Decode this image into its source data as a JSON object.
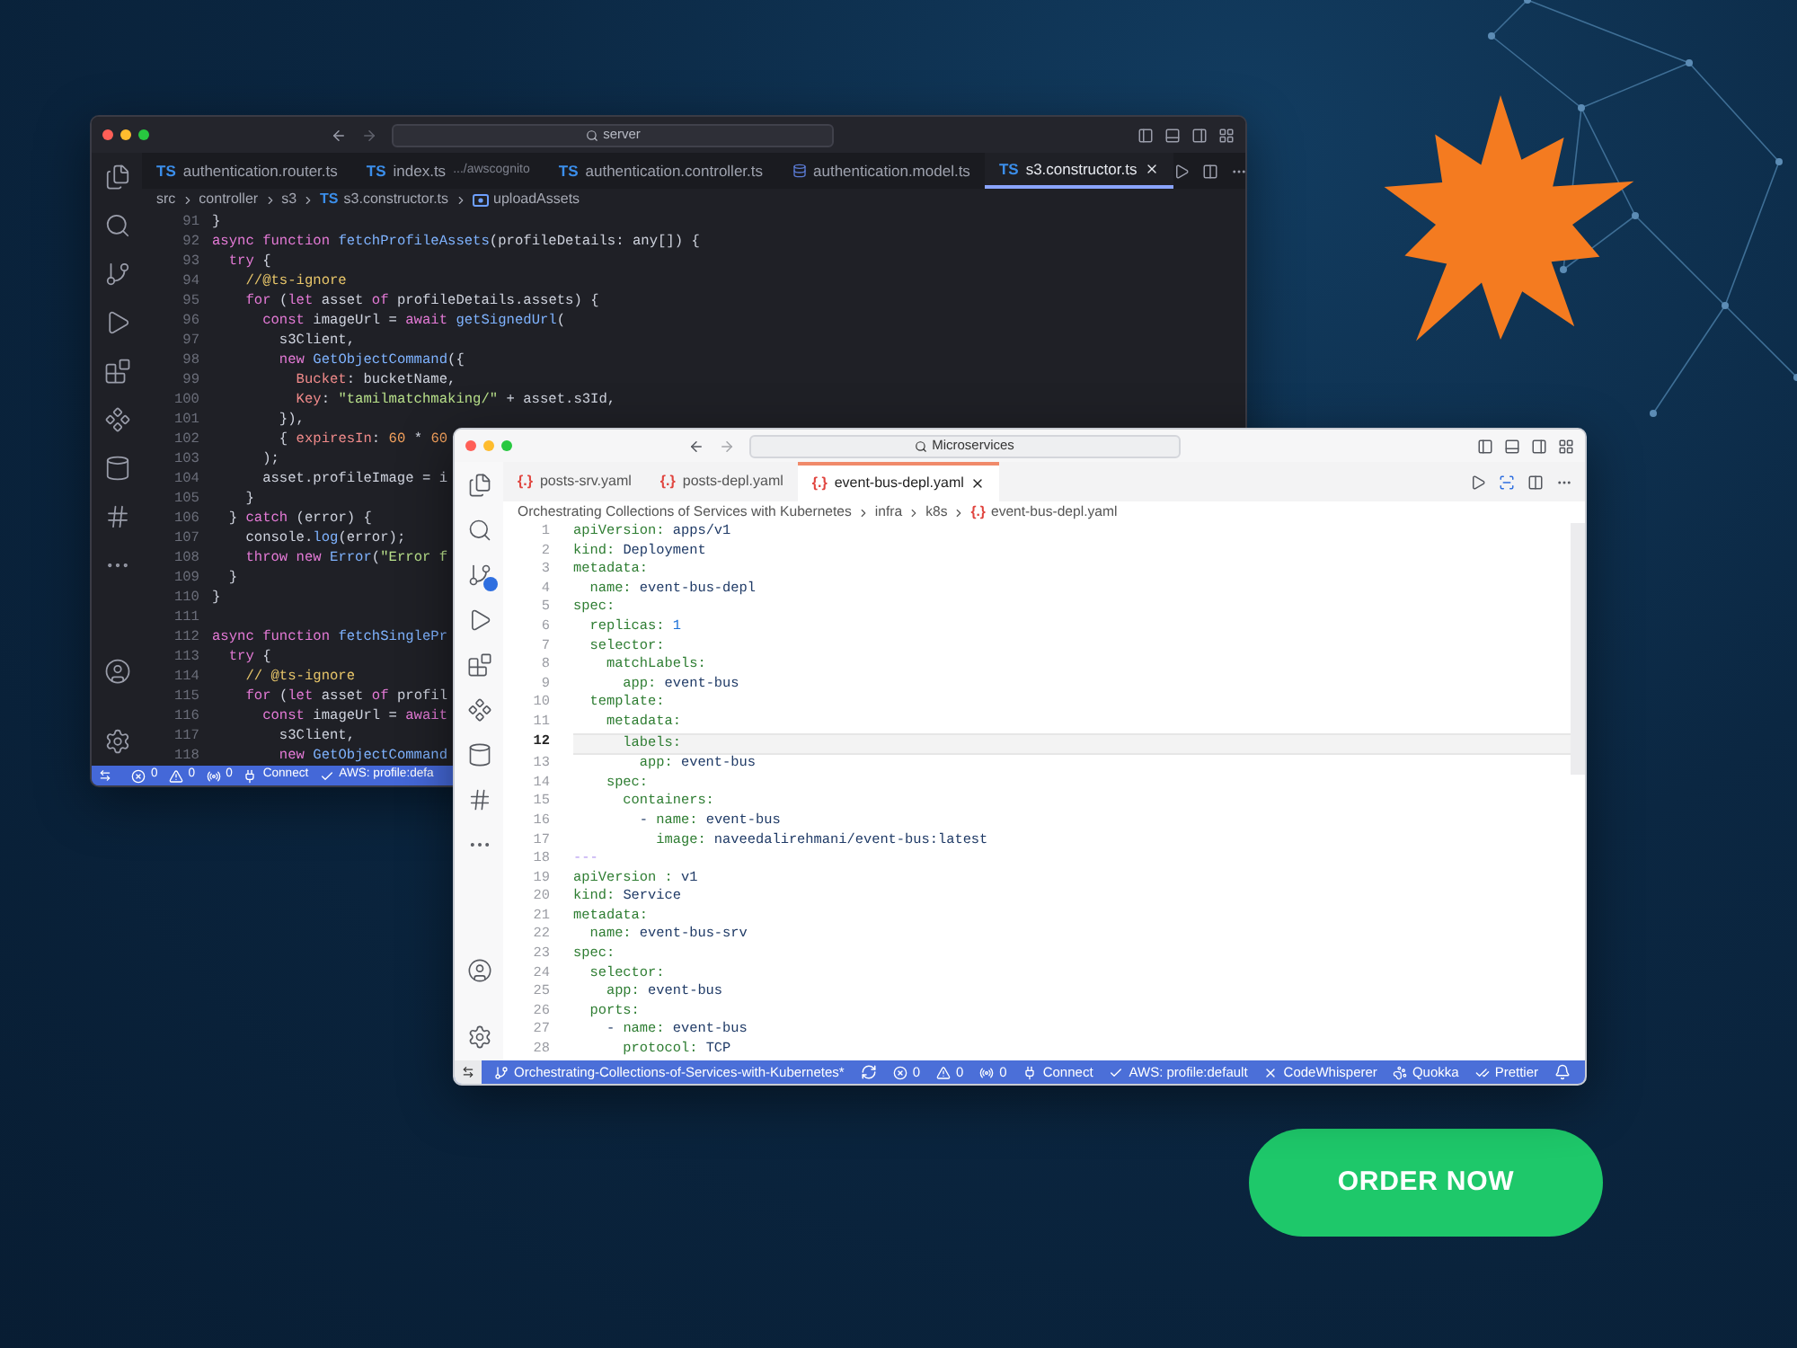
{
  "windows": [
    {
      "kind": "dark",
      "title": "server",
      "tabs": [
        {
          "badge": "TS",
          "label": "authentication.router.ts",
          "selected": false
        },
        {
          "badge": "TS",
          "label": "index.ts",
          "detail": ".../awscognito",
          "selected": false
        },
        {
          "badge": "TS",
          "label": "authentication.controller.ts",
          "selected": false
        },
        {
          "label": "authentication.model.ts",
          "selected": false
        },
        {
          "badge": "TS",
          "label": "s3.constructor.ts",
          "selected": true
        }
      ],
      "breadcrumb": [
        {
          "label": "src"
        },
        {
          "label": "controller"
        },
        {
          "label": "s3"
        },
        {
          "badge": "TS",
          "label": "s3.constructor.ts"
        },
        {
          "kind": "symbol",
          "label": "uploadAssets"
        }
      ],
      "lines": [
        {
          "n": "91",
          "s": [
            {
              "kind": "pl",
              "text": "}"
            }
          ]
        },
        {
          "n": "92",
          "s": [
            {
              "kind": "kw",
              "text": "async function "
            },
            {
              "kind": "fn",
              "text": "fetchProfileAssets"
            },
            {
              "kind": "pl",
              "text": "(profileDetails: any[]) {"
            }
          ]
        },
        {
          "n": "93",
          "s": [
            {
              "kind": "kw",
              "text": "  try "
            },
            {
              "kind": "pl",
              "text": "{"
            }
          ]
        },
        {
          "n": "94",
          "s": [
            {
              "kind": "cm",
              "text": "    //@ts-ignore"
            }
          ]
        },
        {
          "n": "95",
          "s": [
            {
              "kind": "kw",
              "text": "    for "
            },
            {
              "kind": "pl",
              "text": "("
            },
            {
              "kind": "kw",
              "text": "let "
            },
            {
              "kind": "pl",
              "text": "asset "
            },
            {
              "kind": "kw",
              "text": "of "
            },
            {
              "kind": "pl",
              "text": "profileDetails.assets) {"
            }
          ]
        },
        {
          "n": "96",
          "s": [
            {
              "kind": "kw",
              "text": "      const "
            },
            {
              "kind": "pl",
              "text": "imageUrl = "
            },
            {
              "kind": "kw",
              "text": "await "
            },
            {
              "kind": "fn",
              "text": "getSignedUrl"
            },
            {
              "kind": "pl",
              "text": "("
            }
          ]
        },
        {
          "n": "97",
          "s": [
            {
              "kind": "pl",
              "text": "        s3Client,"
            }
          ]
        },
        {
          "n": "98",
          "s": [
            {
              "kind": "kw",
              "text": "        new "
            },
            {
              "kind": "fn",
              "text": "GetObjectCommand"
            },
            {
              "kind": "pl",
              "text": "({"
            }
          ]
        },
        {
          "n": "99",
          "s": [
            {
              "kind": "pr",
              "text": "          Bucket"
            },
            {
              "kind": "pl",
              "text": ": bucketName,"
            }
          ]
        },
        {
          "n": "100",
          "s": [
            {
              "kind": "pr",
              "text": "          Key"
            },
            {
              "kind": "pl",
              "text": ": "
            },
            {
              "kind": "st",
              "text": "\"tamilmatchmaking/\""
            },
            {
              "kind": "pl",
              "text": " + asset.s3Id,"
            }
          ]
        },
        {
          "n": "101",
          "s": [
            {
              "kind": "pl",
              "text": "        }),"
            }
          ]
        },
        {
          "n": "102",
          "s": [
            {
              "kind": "pl",
              "text": "        { "
            },
            {
              "kind": "pr",
              "text": "expiresIn"
            },
            {
              "kind": "pl",
              "text": ": "
            },
            {
              "kind": "nu",
              "text": "60"
            },
            {
              "kind": "pl",
              "text": " * "
            },
            {
              "kind": "nu",
              "text": "60"
            }
          ]
        },
        {
          "n": "103",
          "s": [
            {
              "kind": "pl",
              "text": "      );"
            }
          ]
        },
        {
          "n": "104",
          "s": [
            {
              "kind": "pl",
              "text": "      asset.profileImage = i"
            }
          ]
        },
        {
          "n": "105",
          "s": [
            {
              "kind": "pl",
              "text": "    }"
            }
          ]
        },
        {
          "n": "106",
          "s": [
            {
              "kind": "pl",
              "text": "  } "
            },
            {
              "kind": "kw",
              "text": "catch "
            },
            {
              "kind": "pl",
              "text": "(error) {"
            }
          ]
        },
        {
          "n": "107",
          "s": [
            {
              "kind": "pl",
              "text": "    console."
            },
            {
              "kind": "fn",
              "text": "log"
            },
            {
              "kind": "pl",
              "text": "(error);"
            }
          ]
        },
        {
          "n": "108",
          "s": [
            {
              "kind": "kw",
              "text": "    throw new "
            },
            {
              "kind": "fn",
              "text": "Error"
            },
            {
              "kind": "pl",
              "text": "("
            },
            {
              "kind": "st",
              "text": "\"Error f"
            }
          ]
        },
        {
          "n": "109",
          "s": [
            {
              "kind": "pl",
              "text": "  }"
            }
          ]
        },
        {
          "n": "110",
          "s": [
            {
              "kind": "pl",
              "text": "}"
            }
          ]
        },
        {
          "n": "111"
        },
        {
          "n": "112",
          "s": [
            {
              "kind": "kw",
              "text": "async function "
            },
            {
              "kind": "fn",
              "text": "fetchSinglePr"
            }
          ]
        },
        {
          "n": "113",
          "s": [
            {
              "kind": "kw",
              "text": "  try "
            },
            {
              "kind": "pl",
              "text": "{"
            }
          ]
        },
        {
          "n": "114",
          "s": [
            {
              "kind": "cm",
              "text": "    // @ts-ignore"
            }
          ]
        },
        {
          "n": "115",
          "s": [
            {
              "kind": "kw",
              "text": "    for "
            },
            {
              "kind": "pl",
              "text": "("
            },
            {
              "kind": "kw",
              "text": "let "
            },
            {
              "kind": "pl",
              "text": "asset "
            },
            {
              "kind": "kw",
              "text": "of "
            },
            {
              "kind": "pl",
              "text": "profil"
            }
          ]
        },
        {
          "n": "116",
          "s": [
            {
              "kind": "kw",
              "text": "      const "
            },
            {
              "kind": "pl",
              "text": "imageUrl = "
            },
            {
              "kind": "kw",
              "text": "await"
            }
          ]
        },
        {
          "n": "117",
          "s": [
            {
              "kind": "pl",
              "text": "        s3Client,"
            }
          ]
        },
        {
          "n": "118",
          "s": [
            {
              "kind": "kw",
              "text": "        new "
            },
            {
              "kind": "fn",
              "text": "GetObjectCommand"
            }
          ]
        }
      ],
      "status": [
        {
          "kind": "error",
          "label": "0"
        },
        {
          "kind": "warning",
          "label": "0"
        },
        {
          "kind": "ports",
          "label": "0"
        },
        {
          "kind": "plug",
          "label": "Connect"
        },
        {
          "kind": "check",
          "label": "AWS: profile:defa"
        }
      ]
    },
    {
      "kind": "light",
      "title": "Microservices",
      "tabs": [
        {
          "badge": "{.}",
          "label": "posts-srv.yaml",
          "selected": false
        },
        {
          "badge": "{.}",
          "label": "posts-depl.yaml",
          "selected": false
        },
        {
          "badge": "{.}",
          "label": "event-bus-depl.yaml",
          "selected": true
        }
      ],
      "breadcrumb": [
        {
          "label": "Orchestrating Collections of Services with Kubernetes"
        },
        {
          "label": "infra"
        },
        {
          "label": "k8s"
        },
        {
          "badge": "{.}",
          "label": "event-bus-depl.yaml"
        }
      ],
      "lines": [
        {
          "n": "1",
          "current": false,
          "s": [
            {
              "kind": "ky",
              "text": "apiVersion:"
            },
            {
              "kind": "va",
              "text": " apps/v1"
            }
          ]
        },
        {
          "n": "2",
          "current": false,
          "s": [
            {
              "kind": "ky",
              "text": "kind:"
            },
            {
              "kind": "va",
              "text": " Deployment"
            }
          ]
        },
        {
          "n": "3",
          "current": false,
          "s": [
            {
              "kind": "ky",
              "text": "metadata:"
            }
          ]
        },
        {
          "n": "4",
          "current": false,
          "s": [
            {
              "kind": "ky",
              "text": "  name:"
            },
            {
              "kind": "va",
              "text": " event-bus-depl"
            }
          ]
        },
        {
          "n": "5",
          "current": false,
          "s": [
            {
              "kind": "ky",
              "text": "spec:"
            }
          ]
        },
        {
          "n": "6",
          "current": false,
          "s": [
            {
              "kind": "ky",
              "text": "  replicas:"
            },
            {
              "kind": "nu",
              "text": " 1"
            }
          ]
        },
        {
          "n": "7",
          "current": false,
          "s": [
            {
              "kind": "ky",
              "text": "  selector:"
            }
          ]
        },
        {
          "n": "8",
          "current": false,
          "s": [
            {
              "kind": "ky",
              "text": "    matchLabels:"
            }
          ]
        },
        {
          "n": "9",
          "current": false,
          "s": [
            {
              "kind": "ky",
              "text": "      app:"
            },
            {
              "kind": "va",
              "text": " event-bus"
            }
          ]
        },
        {
          "n": "10",
          "current": false,
          "s": [
            {
              "kind": "ky",
              "text": "  template:"
            }
          ]
        },
        {
          "n": "11",
          "current": false,
          "s": [
            {
              "kind": "ky",
              "text": "    metadata:"
            }
          ]
        },
        {
          "n": "12",
          "current": true,
          "s": [
            {
              "kind": "ky",
              "text": "      labels:"
            }
          ]
        },
        {
          "n": "13",
          "current": false,
          "s": [
            {
              "kind": "ky",
              "text": "        app:"
            },
            {
              "kind": "va",
              "text": " event-bus"
            }
          ]
        },
        {
          "n": "14",
          "current": false,
          "s": [
            {
              "kind": "ky",
              "text": "    spec:"
            }
          ]
        },
        {
          "n": "15",
          "current": false,
          "s": [
            {
              "kind": "ky",
              "text": "      containers:"
            }
          ]
        },
        {
          "n": "16",
          "current": false,
          "s": [
            {
              "kind": "va",
              "text": "        - "
            },
            {
              "kind": "ky",
              "text": "name:"
            },
            {
              "kind": "va",
              "text": " event-bus"
            }
          ]
        },
        {
          "n": "17",
          "current": false,
          "s": [
            {
              "kind": "ky",
              "text": "          image:"
            },
            {
              "kind": "va",
              "text": " naveedalirehmani/event-bus:latest"
            }
          ]
        },
        {
          "n": "18",
          "current": false,
          "s": [
            {
              "kind": "sp",
              "text": "---"
            }
          ]
        },
        {
          "n": "19",
          "current": false,
          "s": [
            {
              "kind": "ky",
              "text": "apiVersion :"
            },
            {
              "kind": "va",
              "text": " v1"
            }
          ]
        },
        {
          "n": "20",
          "current": false,
          "s": [
            {
              "kind": "ky",
              "text": "kind:"
            },
            {
              "kind": "va",
              "text": " Service"
            }
          ]
        },
        {
          "n": "21",
          "current": false,
          "s": [
            {
              "kind": "ky",
              "text": "metadata:"
            }
          ]
        },
        {
          "n": "22",
          "current": false,
          "s": [
            {
              "kind": "ky",
              "text": "  name:"
            },
            {
              "kind": "va",
              "text": " event-bus-srv"
            }
          ]
        },
        {
          "n": "23",
          "current": false,
          "s": [
            {
              "kind": "ky",
              "text": "spec:"
            }
          ]
        },
        {
          "n": "24",
          "current": false,
          "s": [
            {
              "kind": "ky",
              "text": "  selector:"
            }
          ]
        },
        {
          "n": "25",
          "current": false,
          "s": [
            {
              "kind": "ky",
              "text": "    app:"
            },
            {
              "kind": "va",
              "text": " event-bus"
            }
          ]
        },
        {
          "n": "26",
          "current": false,
          "s": [
            {
              "kind": "ky",
              "text": "  ports:"
            }
          ]
        },
        {
          "n": "27",
          "current": false,
          "s": [
            {
              "kind": "va",
              "text": "    - "
            },
            {
              "kind": "ky",
              "text": "name:"
            },
            {
              "kind": "va",
              "text": " event-bus"
            }
          ]
        },
        {
          "n": "28",
          "current": false,
          "s": [
            {
              "kind": "ky",
              "text": "      protocol:"
            },
            {
              "kind": "va",
              "text": " TCP"
            }
          ]
        }
      ],
      "status": [
        {
          "kind": "branch",
          "label": "Orchestrating-Collections-of-Services-with-Kubernetes*"
        },
        {
          "kind": "sync"
        },
        {
          "kind": "error",
          "label": "0"
        },
        {
          "kind": "warning",
          "label": "0"
        },
        {
          "kind": "ports",
          "label": "0"
        },
        {
          "kind": "plug",
          "label": "Connect"
        },
        {
          "kind": "check",
          "label": "AWS: profile:default"
        },
        {
          "kind": "x",
          "label": "CodeWhisperer"
        }
      ],
      "status_right": [
        {
          "kind": "quokka",
          "label": "Quokka"
        },
        {
          "kind": "prettier",
          "label": "Prettier"
        },
        {
          "kind": "bell"
        }
      ]
    }
  ],
  "order_button": "ORDER NOW"
}
